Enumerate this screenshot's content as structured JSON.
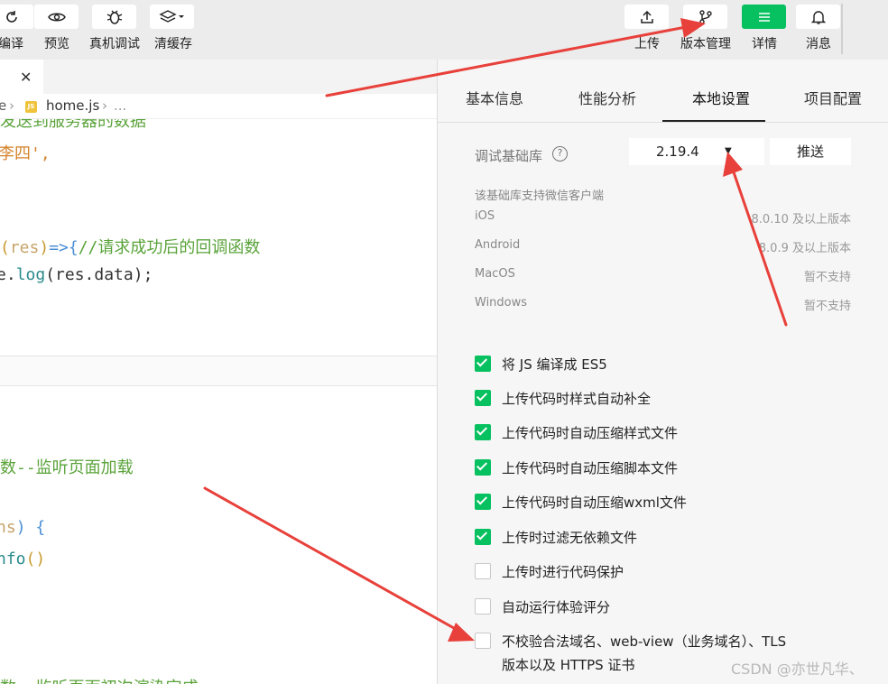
{
  "toolbar": {
    "items": [
      {
        "label": "编译",
        "icon": "refresh-icon"
      },
      {
        "label": "预览",
        "icon": "eye-icon"
      },
      {
        "label": "真机调试",
        "icon": "bug-icon"
      },
      {
        "label": "清缓存",
        "icon": "layers-icon"
      }
    ],
    "right_items": [
      {
        "label": "上传",
        "icon": "upload-icon"
      },
      {
        "label": "版本管理",
        "icon": "branch-icon"
      },
      {
        "label": "详情",
        "icon": "menu-icon"
      },
      {
        "label": "消息",
        "icon": "bell-icon"
      }
    ],
    "accent": "#07c160"
  },
  "editor": {
    "tab_close": "✕",
    "breadcrumb": {
      "part1": "e",
      "file": "home.js",
      "more": "..."
    },
    "code_lines": {
      "l1": "发送到服务器的数据",
      "l2": "李四',",
      "l3_paren_open": "(",
      "l3_arg": "res",
      "l3_paren_close": ")",
      "l3_arrow": "=>{",
      "l3_comment": "//请求成功后的回调函数",
      "l4_pre": "e.",
      "l4_fn": "log",
      "l4_args": "(res.data);",
      "l5": "数--监听页面加载",
      "l6_arg": "ns",
      "l6_rest": ") {",
      "l7_fn": "nfo",
      "l7_rest": "()",
      "l8": "数--监听页面初次渲染完成"
    }
  },
  "panel": {
    "tabs": [
      "基本信息",
      "性能分析",
      "本地设置",
      "项目配置"
    ],
    "active_tab": "本地设置",
    "lib_label": "调试基础库",
    "lib_version": "2.19.4",
    "push_label": "推送",
    "note": "该基础库支持微信客户端",
    "systems": [
      {
        "name": "iOS",
        "ver": "8.0.10 及以上版本"
      },
      {
        "name": "Android",
        "ver": "8.0.9 及以上版本"
      },
      {
        "name": "MacOS",
        "ver": "暂不支持"
      },
      {
        "name": "Windows",
        "ver": "暂不支持"
      }
    ],
    "options": [
      {
        "label": "将 JS 编译成 ES5",
        "checked": true
      },
      {
        "label": "上传代码时样式自动补全",
        "checked": true
      },
      {
        "label": "上传代码时自动压缩样式文件",
        "checked": true
      },
      {
        "label": "上传代码时自动压缩脚本文件",
        "checked": true
      },
      {
        "label": "上传代码时自动压缩wxml文件",
        "checked": true
      },
      {
        "label": "上传时过滤无依赖文件",
        "checked": true
      },
      {
        "label": "上传时进行代码保护",
        "checked": false
      },
      {
        "label": "自动运行体验评分",
        "checked": false
      },
      {
        "label": "不校验合法域名、web-view（业务域名）、TLS",
        "label2": "版本以及 HTTPS 证书",
        "checked": false
      }
    ]
  },
  "watermark": "CSDN @亦世凡华、",
  "colors": {
    "arrow": "#e8403a",
    "check": "#07c160"
  }
}
